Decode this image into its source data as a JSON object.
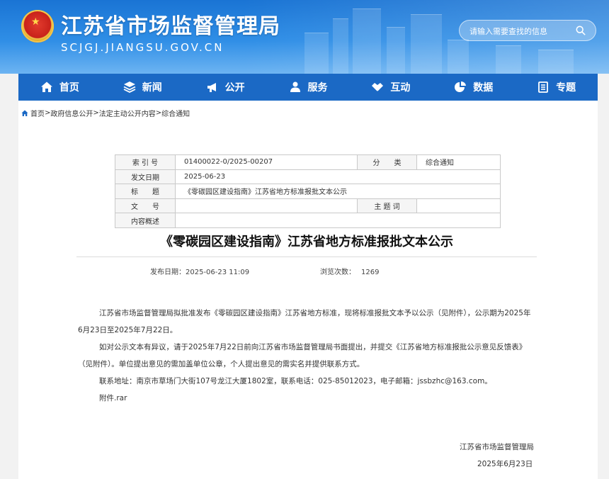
{
  "header": {
    "site_title": "江苏省市场监督管理局",
    "site_domain": "SCJGJ.JIANGSU.GOV.CN",
    "search_placeholder": "请输入需要查找的信息"
  },
  "nav": {
    "items": [
      {
        "label": "首页",
        "icon": "home-icon"
      },
      {
        "label": "新闻",
        "icon": "layers-icon"
      },
      {
        "label": "公开",
        "icon": "megaphone-icon"
      },
      {
        "label": "服务",
        "icon": "people-icon"
      },
      {
        "label": "互动",
        "icon": "handshake-icon"
      },
      {
        "label": "数据",
        "icon": "pie-chart-icon"
      },
      {
        "label": "专题",
        "icon": "document-icon"
      }
    ]
  },
  "breadcrumb": {
    "items": [
      "首页",
      "政府信息公开",
      "法定主动公开内容",
      "综合通知"
    ],
    "separator": ">"
  },
  "meta_table": {
    "index_label": "索 引 号",
    "index_value": "01400022-0/2025-00207",
    "category_label": "分　　类",
    "category_value": "综合通知",
    "date_label": "发文日期",
    "date_value": "2025-06-23",
    "title_label": "标　　题",
    "title_value": "《零碳园区建设指南》江苏省地方标准报批文本公示",
    "docno_label": "文　　号",
    "docno_value": "",
    "keyword_label": "主 题 词",
    "keyword_value": "",
    "summary_label": "内容概述",
    "summary_value": ""
  },
  "article": {
    "title": "《零碳园区建设指南》江苏省地方标准报批文本公示",
    "publish_label": "发布日期：",
    "publish_date": "2025-06-23 11:09",
    "views_label": "浏览次数：",
    "views": "1269",
    "paragraph1": "江苏省市场监督管理局拟批准发布《零碳园区建设指南》江苏省地方标准，现将标准报批文本予以公示（见附件），公示期为2025年6月23日至2025年7月22日。",
    "paragraph2": "如对公示文本有异议，请于2025年7月22日前向江苏省市场监督管理局书面提出，并提交《江苏省地方标准报批公示意见反馈表》（见附件）。单位提出意见的需加盖单位公章，个人提出意见的需实名并提供联系方式。",
    "paragraph3": "联系地址：南京市草场门大街107号龙江大厦1802室，联系电话：025-85012023，电子邮箱：jssbzhc@163.com。",
    "attachment": "附件.rar",
    "signer": "江苏省市场监督管理局",
    "sign_date": "2025年6月23日"
  },
  "colors": {
    "header_blue": "#1a74d4",
    "nav_blue": "#1b69c5"
  }
}
